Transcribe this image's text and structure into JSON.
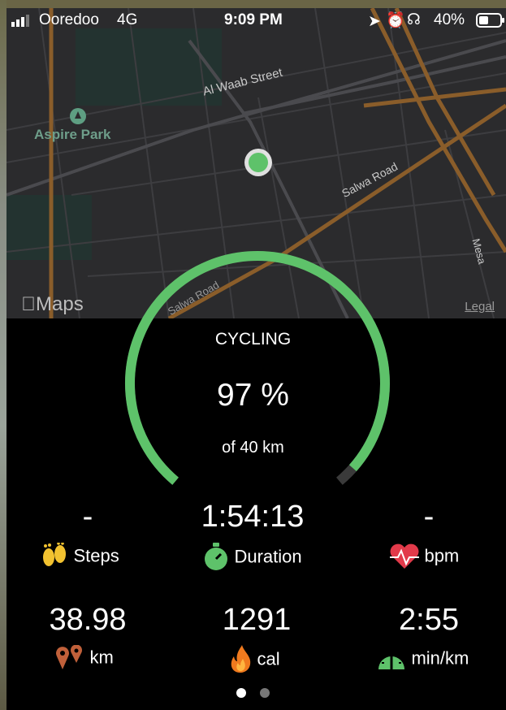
{
  "status_bar": {
    "carrier": "Ooredoo",
    "network": "4G",
    "time": "9:09 PM",
    "battery": "40%"
  },
  "map": {
    "labels": {
      "park": "Aspire Park",
      "street1": "Al Waab Street",
      "street2": "Salwa Road",
      "street3": "Salwa Road",
      "street4": "Mesa",
      "attribution": "Maps",
      "legal": "Legal"
    }
  },
  "activity": {
    "type": "CYCLING",
    "progress_text": "97 %",
    "goal_text": "of 40 km",
    "progress_fraction": 0.97
  },
  "stats": [
    {
      "value": "-",
      "label": "Steps",
      "icon": "footprints-icon"
    },
    {
      "value": "1:54:13",
      "label": "Duration",
      "icon": "stopwatch-icon"
    },
    {
      "value": "-",
      "label": "bpm",
      "icon": "heart-rate-icon"
    },
    {
      "value": "38.98",
      "label": "km",
      "icon": "location-pins-icon"
    },
    {
      "value": "1291",
      "label": "cal",
      "icon": "flame-icon"
    },
    {
      "value": "2:55",
      "label": "min/km",
      "icon": "speedometer-icon"
    }
  ],
  "colors": {
    "accent": "#5ec26a",
    "background": "#000000",
    "map_bg": "#2b2b2d"
  },
  "pager": {
    "pages": 2,
    "current": 1
  }
}
